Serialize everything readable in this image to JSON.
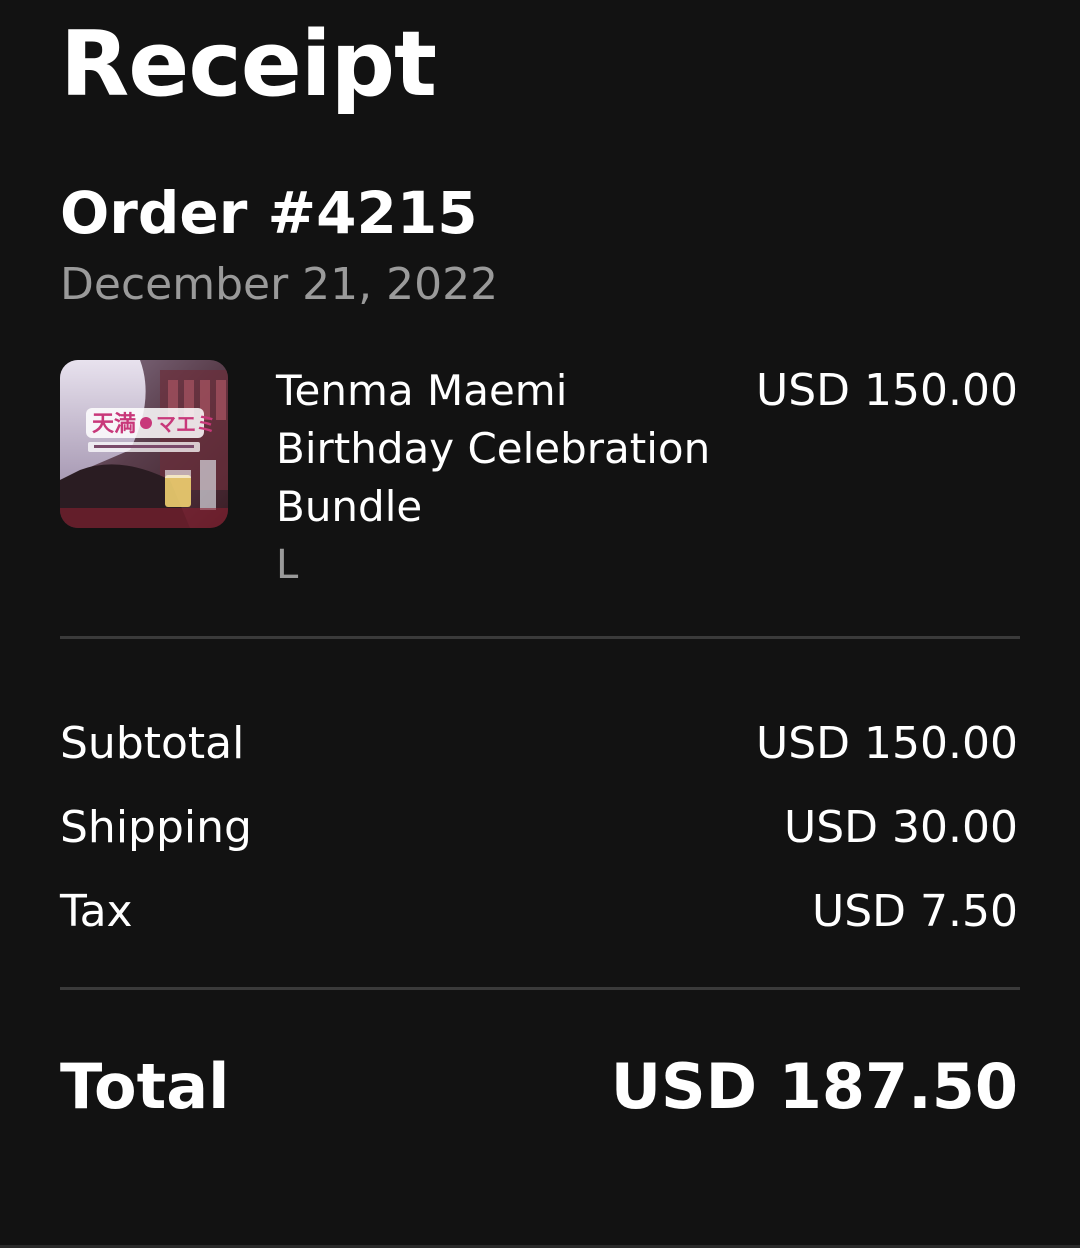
{
  "receipt": {
    "title": "Receipt",
    "order_number": "Order #4215",
    "order_date": "December 21, 2022"
  },
  "item": {
    "name": "Tenma Maemi Birthday Celebration Bundle",
    "variant": "L",
    "price": "USD 150.00",
    "thumbnail_icon": "product-thumbnail-image"
  },
  "summary": {
    "rows": [
      {
        "label": "Subtotal",
        "value": "USD 150.00"
      },
      {
        "label": "Shipping",
        "value": "USD 30.00"
      },
      {
        "label": "Tax",
        "value": "USD 7.50"
      }
    ],
    "total_label": "Total",
    "total_value": "USD 187.50"
  },
  "colors": {
    "background": "#121212",
    "text": "#ffffff",
    "muted": "#9a9a9a",
    "divider": "#3a3a3a"
  }
}
